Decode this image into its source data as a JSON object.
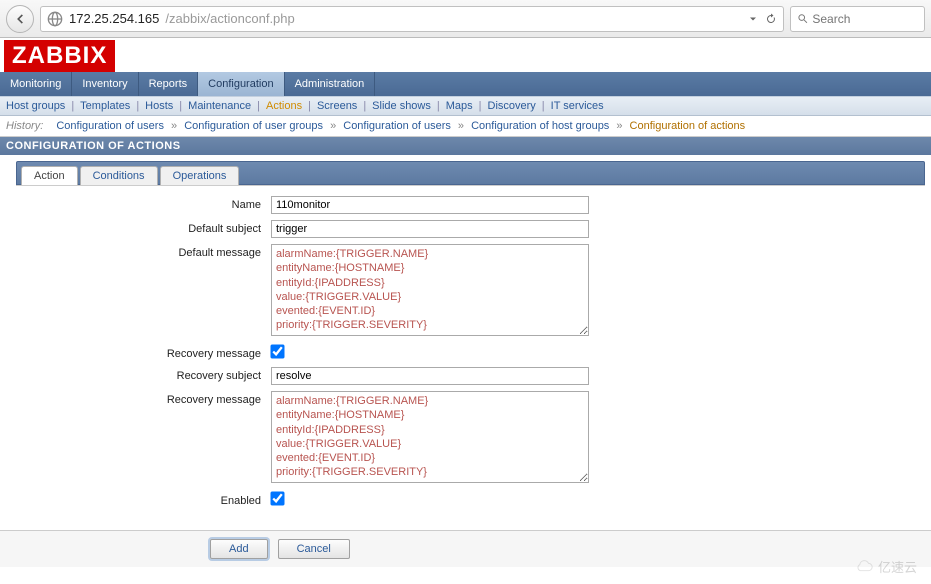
{
  "browser": {
    "url_host": "172.25.254.165",
    "url_path": "/zabbix/actionconf.php",
    "search_placeholder": "Search"
  },
  "logo": "ZABBIX",
  "main_tabs": [
    "Monitoring",
    "Inventory",
    "Reports",
    "Configuration",
    "Administration"
  ],
  "main_tab_active": "Configuration",
  "sub_tabs": [
    "Host groups",
    "Templates",
    "Hosts",
    "Maintenance",
    "Actions",
    "Screens",
    "Slide shows",
    "Maps",
    "Discovery",
    "IT services"
  ],
  "sub_tab_active": "Actions",
  "history": {
    "label": "History:",
    "items": [
      "Configuration of users",
      "Configuration of user groups",
      "Configuration of users",
      "Configuration of host groups",
      "Configuration of actions"
    ]
  },
  "page_title": "CONFIGURATION OF ACTIONS",
  "form_tabs": [
    "Action",
    "Conditions",
    "Operations"
  ],
  "form_tab_active": "Action",
  "form": {
    "name_label": "Name",
    "name_value": "110monitor",
    "default_subject_label": "Default subject",
    "default_subject_value": "trigger",
    "default_message_label": "Default message",
    "default_message_value": "alarmName:{TRIGGER.NAME}\nentityName:{HOSTNAME}\nentityId:{IPADDRESS}\nvalue:{TRIGGER.VALUE}\nevented:{EVENT.ID}\npriority:{TRIGGER.SEVERITY}\nalarmContent:{IPADDRESS} {ITEM.NAME}:{ITEM.VALUE}",
    "recovery_message_label": "Recovery message",
    "recovery_message_checked": true,
    "recovery_subject_label": "Recovery subject",
    "recovery_subject_value": "resolve",
    "recovery_message2_label": "Recovery message",
    "recovery_message2_value": "alarmName:{TRIGGER.NAME}\nentityName:{HOSTNAME}\nentityId:{IPADDRESS}\nvalue:{TRIGGER.VALUE}\nevented:{EVENT.ID}\npriority:{TRIGGER.SEVERITY}\nalarmContent:{IPADDRESS} {ITEM.NAME}:{ITEM.VALUE}",
    "enabled_label": "Enabled",
    "enabled_checked": true
  },
  "buttons": {
    "add": "Add",
    "cancel": "Cancel"
  },
  "watermark": "亿速云"
}
